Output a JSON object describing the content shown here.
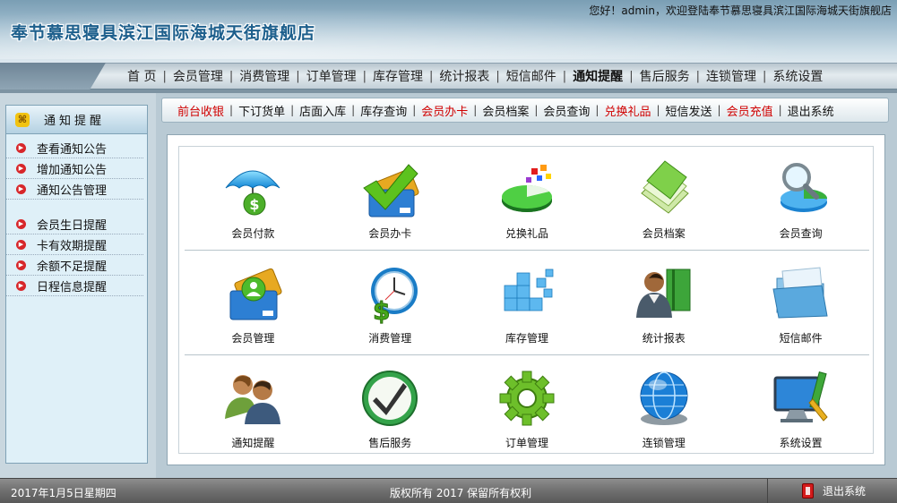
{
  "header": {
    "welcome": "您好！admin，欢迎登陆奉节慕思寝具滨江国际海城天街旗舰店",
    "title": "奉节慕思寝具滨江国际海城天街旗舰店"
  },
  "main_nav": [
    "首 页",
    "会员管理",
    "消费管理",
    "订单管理",
    "库存管理",
    "统计报表",
    "短信邮件",
    "通知提醒",
    "售后服务",
    "连锁管理",
    "系统设置"
  ],
  "main_nav_active": "通知提醒",
  "quick_nav": [
    {
      "label": "前台收银",
      "highlight": true
    },
    {
      "label": "下订货单",
      "highlight": false
    },
    {
      "label": "店面入库",
      "highlight": false
    },
    {
      "label": "库存查询",
      "highlight": false
    },
    {
      "label": "会员办卡",
      "highlight": true
    },
    {
      "label": "会员档案",
      "highlight": false
    },
    {
      "label": "会员查询",
      "highlight": false
    },
    {
      "label": "兑换礼品",
      "highlight": true
    },
    {
      "label": "短信发送",
      "highlight": false
    },
    {
      "label": "会员充值",
      "highlight": true
    },
    {
      "label": "退出系统",
      "highlight": false
    }
  ],
  "sidebar": {
    "title": "通知提醒",
    "groups": [
      [
        "查看通知公告",
        "增加通知公告",
        "通知公告管理"
      ],
      [
        "会员生日提醒",
        "卡有效期提醒",
        "余额不足提醒",
        "日程信息提醒"
      ]
    ]
  },
  "tiles": [
    [
      {
        "label": "会员付款",
        "icon": "umbrella-dollar-icon"
      },
      {
        "label": "会员办卡",
        "icon": "check-card-icon"
      },
      {
        "label": "兑换礼品",
        "icon": "pie-chart-icon"
      },
      {
        "label": "会员档案",
        "icon": "folder-files-icon"
      },
      {
        "label": "会员查询",
        "icon": "magnifier-icon"
      }
    ],
    [
      {
        "label": "会员管理",
        "icon": "member-card-icon"
      },
      {
        "label": "消费管理",
        "icon": "clock-dollar-icon"
      },
      {
        "label": "库存管理",
        "icon": "cubes-icon"
      },
      {
        "label": "统计报表",
        "icon": "person-book-icon"
      },
      {
        "label": "短信邮件",
        "icon": "open-folder-icon"
      }
    ],
    [
      {
        "label": "通知提醒",
        "icon": "users-icon"
      },
      {
        "label": "售后服务",
        "icon": "checkmark-circle-icon"
      },
      {
        "label": "订单管理",
        "icon": "gear-icon"
      },
      {
        "label": "连锁管理",
        "icon": "globe-icon"
      },
      {
        "label": "系统设置",
        "icon": "monitor-tools-icon"
      }
    ]
  ],
  "footer": {
    "date": "2017年1月5日星期四",
    "copyright": "版权所有 2017 保留所有权利",
    "exit_label": "退出系统"
  },
  "colors": {
    "highlight": "#d00000",
    "title": "#1d5f8c",
    "footer": "#6f6f6f"
  }
}
